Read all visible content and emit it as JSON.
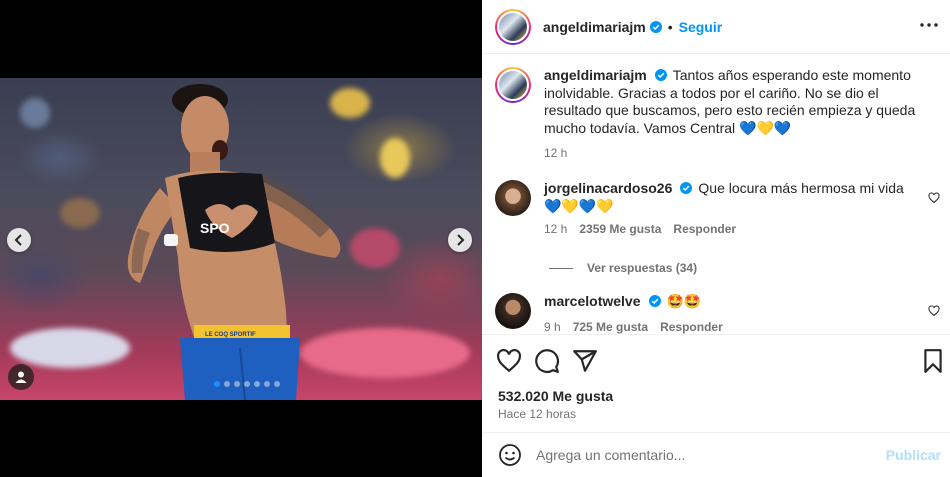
{
  "post": {
    "author": "angeldimariajm",
    "follow_label": "Seguir",
    "separator": "•",
    "caption_user": "angeldimariajm",
    "caption": "Tantos años esperando este momento inolvidable. Gracias a todos por el cariño. No se dio el resultado que buscamos, pero esto recién empieza y queda mucho todavía. Vamos Central 💙💛💙",
    "caption_time": "12 h",
    "likes": "532.020 Me gusta",
    "time_ago": "Hace 12 horas"
  },
  "media": {
    "jersey_text": "SPO",
    "shorts_text": "LE COQ SPORTIF",
    "carousel_total": 7,
    "carousel_active": 0
  },
  "comments": [
    {
      "user": "jorgelinacardoso26",
      "text": "Que locura más hermosa mi vida",
      "emojis": "💙💛💙💛",
      "time": "12 h",
      "likes": "2359 Me gusta",
      "reply": "Responder"
    },
    {
      "user": "marcelotwelve",
      "text": "🤩🤩",
      "time": "9 h",
      "likes": "725 Me gusta",
      "reply": "Responder"
    }
  ],
  "view_replies": "Ver respuestas (34)",
  "composer": {
    "placeholder": "Agrega un comentario...",
    "publish": "Publicar"
  },
  "colors": {
    "accent": "#0095f6",
    "publish_disabled": "#b2dffc",
    "muted": "#737373",
    "carousel_active": "#1e90ff"
  },
  "icons": [
    "verified-badge-icon",
    "more-options-icon",
    "heart-icon",
    "comment-icon",
    "share-icon",
    "bookmark-icon",
    "emoji-icon",
    "chevron-left-icon",
    "chevron-right-icon",
    "user-tag-icon"
  ]
}
